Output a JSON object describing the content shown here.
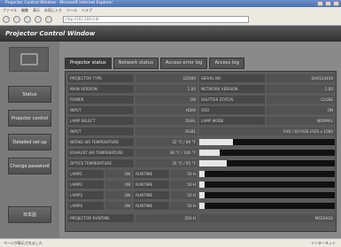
{
  "browser": {
    "title": "Projector Control Window - Microsoft Internet Explorer",
    "menu": [
      "ファイル",
      "編集",
      "表示",
      "お気に入り",
      "ツール",
      "ヘルプ"
    ],
    "address": "http://192.168.0.8/",
    "status_left": "ページが表示されました",
    "status_right": "インターネット"
  },
  "banner": {
    "title": "Projector Control Window"
  },
  "sidebar": {
    "buttons": [
      {
        "label": "Status"
      },
      {
        "label": "Projector control"
      },
      {
        "label": "Detailed set up"
      },
      {
        "label": "Change password"
      },
      {
        "label": "日本語"
      }
    ]
  },
  "tabs": [
    {
      "label": "Projector status"
    },
    {
      "label": "Network status"
    },
    {
      "label": "Access error log"
    },
    {
      "label": "Access log"
    }
  ],
  "status_rows": [
    {
      "label": "PROJECTOR TYPE",
      "value": "DZ680",
      "label2": "SERIAL NO",
      "value2": "SH0123456"
    },
    {
      "label": "MAIN VERSION",
      "value": "1.00",
      "label2": "NETWORK VERSION",
      "value2": "1.00"
    },
    {
      "label": "POWER",
      "value": "ON",
      "label2": "SHUTTER STATUS",
      "value2": "CLOSE"
    },
    {
      "label": "INPUT",
      "value": "HDMI",
      "label2": "OSD",
      "value2": "ON"
    },
    {
      "label": "LAMP SELECT",
      "value": "DUAL",
      "label2": "LAMP MODE",
      "value2": "NORMAL"
    },
    {
      "label": "INPUT",
      "value": "RGB1",
      "label2": "",
      "value2": "FHD / 60 RGB 1920 x 1080"
    },
    {
      "label": "INTAKE AIR TEMPERATURE",
      "value": "32 °C / 89 °F",
      "bar": 0.25
    },
    {
      "label": "EXHAUST AIR TEMPERATURE",
      "value": "38 °C / 100 °F",
      "bar": 0.15
    },
    {
      "label": "OPTICS TEMPERATURE",
      "value": "35 °C / 95 °F",
      "bar": 0.2
    },
    {
      "label": "LAMP1",
      "value": "ON",
      "label2": "RUNTIME",
      "value2": "50 H",
      "bar": 0.04
    },
    {
      "label": "LAMP2",
      "value": "ON",
      "label2": "RUNTIME",
      "value2": "50 H",
      "bar": 0.04
    },
    {
      "label": "LAMP3",
      "value": "ON",
      "label2": "RUNTIME",
      "value2": "50 H",
      "bar": 0.04
    },
    {
      "label": "LAMP4",
      "value": "ON",
      "label2": "RUNTIME",
      "value2": "50 H",
      "bar": 0.04
    },
    {
      "label": "PROJECTOR RUNTIME",
      "value": "200 H",
      "label2": "",
      "value2": "MESSAGE"
    }
  ]
}
